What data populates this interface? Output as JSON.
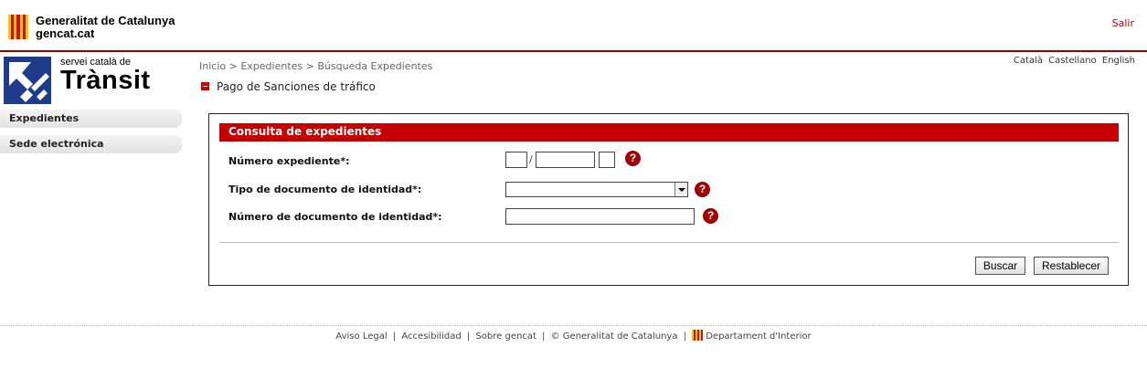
{
  "header": {
    "brand_line1": "Generalitat de Catalunya",
    "brand_line2": "gencat.cat",
    "logout": "Salir"
  },
  "brand": {
    "small": "servei català de",
    "big": "Trànsit"
  },
  "nav": {
    "items": [
      {
        "label": "Expedientes"
      },
      {
        "label": "Sede electrónica"
      }
    ]
  },
  "breadcrumb": {
    "items": [
      "Inicio",
      "Expedientes",
      "Búsqueda Expedientes"
    ],
    "separator": ">"
  },
  "languages": [
    "Català",
    "Castellano",
    "English"
  ],
  "section": {
    "title": "Pago de Sanciones de tráfico"
  },
  "form": {
    "title": "Consulta de expedientes",
    "expediente_label": "Número expediente*:",
    "slash": "/",
    "expediente_values": [
      "",
      "",
      ""
    ],
    "doc_type_label": "Tipo de documento de identidad*:",
    "doc_type_value": "",
    "doc_number_label": "Número de documento de identidad*:",
    "doc_number_value": "",
    "help": "?",
    "search_button": "Buscar",
    "reset_button": "Restablecer"
  },
  "footer": {
    "links": [
      "Aviso Legal",
      "Accesibilidad",
      "Sobre gencat",
      "© Generalitat de Catalunya",
      "Departament d'Interior"
    ],
    "separator": "|"
  },
  "colors": {
    "accent": "#c60000",
    "header_border": "#9b0000",
    "brand_blue": "#1f3c8c"
  }
}
